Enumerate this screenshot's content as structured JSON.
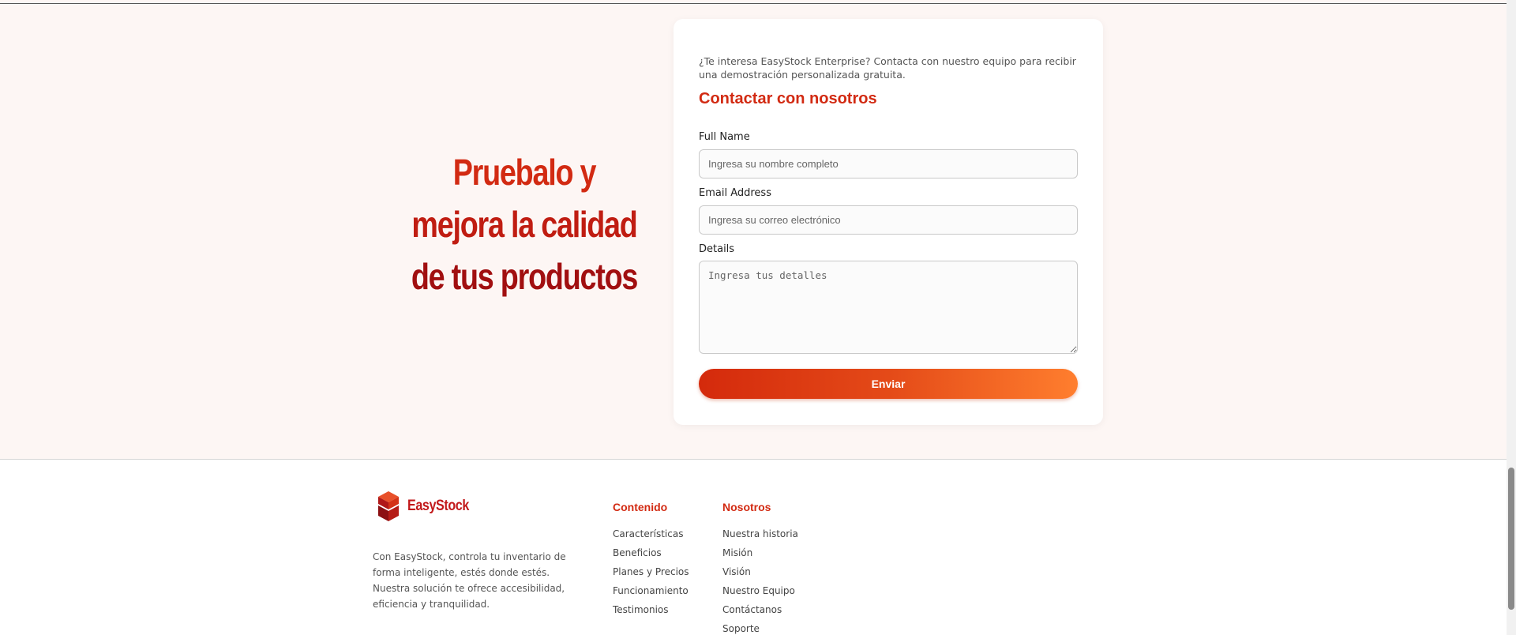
{
  "hero": {
    "heading_line1": "Pruebalo y",
    "heading_line2": "mejora la calidad",
    "heading_line3": "de tus productos"
  },
  "contact_form": {
    "intro": "¿Te interesa EasyStock Enterprise? Contacta con nuestro equipo para recibir una demostración personalizada gratuita.",
    "title": "Contactar con nosotros",
    "full_name_label": "Full Name",
    "full_name_placeholder": "Ingresa su nombre completo",
    "email_label": "Email Address",
    "email_placeholder": "Ingresa su correo electrónico",
    "details_label": "Details",
    "details_placeholder": "Ingresa tus detalles",
    "submit_label": "Enviar"
  },
  "footer": {
    "brand": "EasyStock",
    "description": "Con EasyStock, controla tu inventario de forma inteligente, estés donde estés. Nuestra solución te ofrece accesibilidad, eficiencia y tranquilidad.",
    "columns": [
      {
        "title": "Contenido",
        "links": [
          "Características",
          "Beneficios",
          "Planes y Precios",
          "Funcionamiento",
          "Testimonios"
        ]
      },
      {
        "title": "Nosotros",
        "links": [
          "Nuestra historia",
          "Misión",
          "Visión",
          "Nuestro Equipo",
          "Contáctanos",
          "Soporte"
        ]
      }
    ]
  },
  "colors": {
    "accent": "#d22a12",
    "accent_dark": "#a10f10",
    "button_gradient_start": "#d42a0c",
    "button_gradient_end": "#ff7e2e",
    "page_background": "#fdf6f4"
  },
  "icons": {
    "logo": "cube-stack-icon"
  }
}
